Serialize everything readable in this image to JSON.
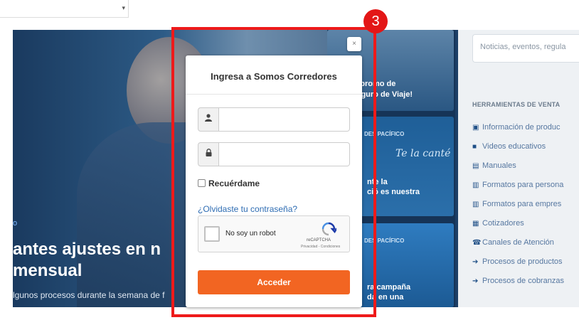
{
  "top_select": {
    "arrow": "▾"
  },
  "hero": {
    "dot": "o",
    "title_line1": "antes ajustes en n",
    "title_line2": "mensual",
    "subtitle": "lgunos procesos durante la semana de f"
  },
  "cards": {
    "card1": {
      "line1": "la promo de",
      "line2": "Seguro de Viaje!"
    },
    "card2": {
      "tag": "DES PACÍFICO",
      "script": "Te la canté",
      "line1": "nte la",
      "line2": "ció es nuestra"
    },
    "card3": {
      "tag": "DES PACÍFICO",
      "line1": "ra campaña",
      "line2": "da en una"
    }
  },
  "sidebar": {
    "search_placeholder": "Noticias, eventos, regula",
    "section_title": "HERRAMIENTAS DE VENTA",
    "items": [
      {
        "icon": "▣",
        "label": "Información de produc"
      },
      {
        "icon": "■",
        "label": "Videos educativos"
      },
      {
        "icon": "▤",
        "label": "Manuales"
      },
      {
        "icon": "▥",
        "label": "Formatos para persona"
      },
      {
        "icon": "▥",
        "label": "Formatos para empres"
      },
      {
        "icon": "▦",
        "label": "Cotizadores"
      },
      {
        "icon": "☎",
        "label": "Canales de Atención"
      },
      {
        "icon": "➔",
        "label": "Procesos de productos"
      },
      {
        "icon": "➔",
        "label": "Procesos de cobranzas"
      }
    ]
  },
  "annotation": {
    "badge": "3",
    "color": "#ee1a1a"
  },
  "modal": {
    "close": "×",
    "title": "Ingresa a Somos Corredores",
    "user_icon": "👤",
    "lock_icon": "🔒",
    "remember_label": "Recuérdame",
    "forgot_link": "¿Olvidaste tu contraseña?",
    "captcha": {
      "label": "No soy un robot",
      "brand": "reCAPTCHA",
      "terms": "Privacidad - Condiciones"
    },
    "submit_label": "Acceder",
    "accent_color": "#f26522"
  }
}
